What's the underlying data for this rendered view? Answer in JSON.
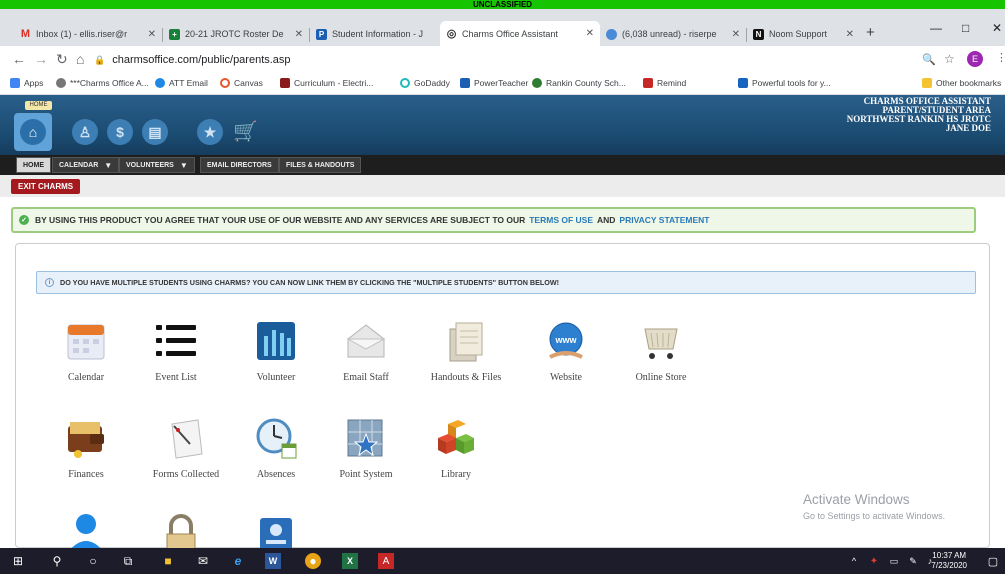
{
  "banner": "UNCLASSIFIED",
  "tabs": [
    {
      "title": "Inbox (1) - ellis.riser@r",
      "icon": "gmail-icon",
      "color": "#d93025",
      "glyph": "M"
    },
    {
      "title": "20-21 JROTC Roster De",
      "icon": "sheets-icon",
      "color": "#188038",
      "glyph": "+"
    },
    {
      "title": "Student Information - J",
      "icon": "powerteacher-icon",
      "color": "#1a5fb4",
      "glyph": "P"
    },
    {
      "title": "Charms Office Assistant",
      "icon": "charms-icon",
      "color": "#333333",
      "glyph": "◎"
    },
    {
      "title": "(6,038 unread) - riserpe",
      "icon": "yahoo-icon",
      "color": "#4a8ad6",
      "glyph": "●"
    },
    {
      "title": "Noom Support",
      "icon": "noom-icon",
      "color": "#111111",
      "glyph": "N"
    }
  ],
  "window": {
    "minimize": "—",
    "restore": "□",
    "close": "✕",
    "newtab": "+"
  },
  "omnibar": {
    "url": "charmsoffice.com/public/parents.asp",
    "profile": "E"
  },
  "bookmarks": [
    {
      "label": "Apps",
      "color": "#4285f4"
    },
    {
      "label": "***Charms Office A...",
      "color": "#777777"
    },
    {
      "label": "ATT Email",
      "color": "#1e88e5"
    },
    {
      "label": "Canvas",
      "color": "#e55a2b"
    },
    {
      "label": "Curriculum - Electri...",
      "color": "#8b1a1a"
    },
    {
      "label": "GoDaddy",
      "color": "#1fb9b9"
    },
    {
      "label": "PowerTeacher",
      "color": "#1a5fb4"
    },
    {
      "label": "Rankin County Sch...",
      "color": "#2e7d32"
    },
    {
      "label": "Remind",
      "color": "#c62828"
    },
    {
      "label": "Powerful tools for y...",
      "color": "#1565c0"
    },
    {
      "label": "Other bookmarks",
      "color": "#f4c430"
    }
  ],
  "header": {
    "home_badge": "HOME",
    "title_lines": [
      "CHARMS OFFICE ASSISTANT",
      "PARENT/STUDENT AREA",
      "NORTHWEST RANKIN HS JROTC",
      "JANE DOE"
    ]
  },
  "menu": [
    {
      "label": "HOME",
      "dropdown": false
    },
    {
      "label": "CALENDAR",
      "dropdown": true
    },
    {
      "label": "VOLUNTEERS",
      "dropdown": true
    },
    {
      "label": "EMAIL DIRECTORS",
      "dropdown": false
    },
    {
      "label": "FILES & HANDOUTS",
      "dropdown": false
    }
  ],
  "exit": "EXIT CHARMS",
  "notice": {
    "pre": "BY USING THIS PRODUCT YOU AGREE THAT YOUR USE OF OUR WEBSITE AND ANY SERVICES ARE SUBJECT TO OUR",
    "link1": "TERMS OF USE",
    "mid": "AND",
    "link2": "PRIVACY STATEMENT"
  },
  "info": "DO YOU HAVE MULTIPLE STUDENTS USING CHARMS? YOU CAN NOW LINK THEM BY CLICKING THE \"MULTIPLE STUDENTS\" BUTTON BELOW!",
  "apps": [
    {
      "label": "Calendar",
      "icon": "calendar-icon"
    },
    {
      "label": "Event List",
      "icon": "event-list-icon"
    },
    {
      "label": "Volunteer",
      "icon": "volunteer-icon"
    },
    {
      "label": "Email Staff",
      "icon": "email-staff-icon"
    },
    {
      "label": "Handouts & Files",
      "icon": "handouts-icon"
    },
    {
      "label": "Website",
      "icon": "website-icon"
    },
    {
      "label": "Online Store",
      "icon": "online-store-icon"
    },
    {
      "label": "Finances",
      "icon": "finances-icon"
    },
    {
      "label": "Forms Collected",
      "icon": "forms-icon"
    },
    {
      "label": "Absences",
      "icon": "absences-icon"
    },
    {
      "label": "Point System",
      "icon": "point-system-icon"
    },
    {
      "label": "Library",
      "icon": "library-icon"
    },
    {
      "label": "",
      "icon": "user-icon"
    },
    {
      "label": "",
      "icon": "lock-icon"
    },
    {
      "label": "",
      "icon": "id-card-icon"
    }
  ],
  "watermark": {
    "title": "Activate Windows",
    "sub": "Go to Settings to activate Windows."
  },
  "taskbar": {
    "time": "10:37 AM",
    "date": "7/23/2020"
  }
}
